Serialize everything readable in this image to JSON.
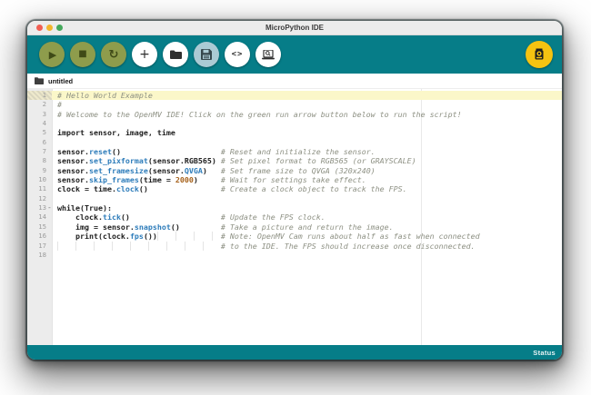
{
  "window": {
    "title": "MicroPython IDE"
  },
  "icons": {
    "play": "▶",
    "stop": "■",
    "reload": "↻",
    "new_file": "+",
    "code": "<>"
  },
  "toolbar": {
    "buttons": [
      {
        "name": "run-script-button",
        "icon": "play-icon"
      },
      {
        "name": "stop-script-button",
        "icon": "stop-icon"
      },
      {
        "name": "reset-camera-button",
        "icon": "reload-icon"
      },
      {
        "name": "new-file-button",
        "icon": "plus-icon"
      },
      {
        "name": "open-file-button",
        "icon": "folder-icon"
      },
      {
        "name": "save-file-button",
        "icon": "floppy-icon"
      },
      {
        "name": "serial-terminal-button",
        "icon": "code-icon"
      },
      {
        "name": "frame-buffer-button",
        "icon": "laptop-zoom-icon"
      },
      {
        "name": "connect-camera-button",
        "icon": "camera-board-icon"
      }
    ]
  },
  "tabbar": {
    "file_label": "untitled"
  },
  "statusbar": {
    "label": "Status"
  },
  "colors": {
    "teal": "#067d88",
    "olive_button": "#8e9c4c",
    "save_button_blue": "#abcad4",
    "connect_yellow": "#f5c311",
    "current_line": "#fbf7c9",
    "comment_gray": "#8d9083",
    "function_blue": "#2d7cba",
    "number_orange": "#a6611a"
  },
  "editor": {
    "lines": [
      {
        "n": 1,
        "cur": true,
        "seg": [
          [
            "c",
            "# Hello World Example"
          ]
        ]
      },
      {
        "n": 2,
        "seg": [
          [
            "c",
            "#"
          ]
        ]
      },
      {
        "n": 3,
        "seg": [
          [
            "c",
            "# Welcome to the OpenMV IDE! Click on the green run arrow button below to run the script!"
          ]
        ]
      },
      {
        "n": 4,
        "seg": []
      },
      {
        "n": 5,
        "seg": [
          [
            "k",
            "import"
          ],
          [
            "v",
            " sensor, image, time"
          ]
        ]
      },
      {
        "n": 6,
        "seg": []
      },
      {
        "n": 7,
        "seg": [
          [
            "v",
            "sensor."
          ],
          [
            "f",
            "reset"
          ],
          [
            "v",
            "()                      "
          ],
          [
            "c",
            "# Reset and initialize the sensor."
          ]
        ]
      },
      {
        "n": 8,
        "seg": [
          [
            "v",
            "sensor."
          ],
          [
            "f",
            "set_pixformat"
          ],
          [
            "v",
            "(sensor.RGB565) "
          ],
          [
            "c",
            "# Set pixel format to RGB565 (or GRAYSCALE)"
          ]
        ]
      },
      {
        "n": 9,
        "seg": [
          [
            "v",
            "sensor."
          ],
          [
            "f",
            "set_framesize"
          ],
          [
            "v",
            "(sensor."
          ],
          [
            "f",
            "QVGA"
          ],
          [
            "v",
            ")   "
          ],
          [
            "c",
            "# Set frame size to QVGA (320x240)"
          ]
        ]
      },
      {
        "n": 10,
        "seg": [
          [
            "v",
            "sensor."
          ],
          [
            "f",
            "skip_frames"
          ],
          [
            "v",
            "(time = "
          ],
          [
            "n2",
            "2000"
          ],
          [
            "v",
            ")     "
          ],
          [
            "c",
            "# Wait for settings take effect."
          ]
        ]
      },
      {
        "n": 11,
        "seg": [
          [
            "v",
            "clock = time."
          ],
          [
            "f",
            "clock"
          ],
          [
            "v",
            "()                "
          ],
          [
            "c",
            "# Create a clock object to track the FPS."
          ]
        ]
      },
      {
        "n": 12,
        "seg": []
      },
      {
        "n": 13,
        "fold": true,
        "seg": [
          [
            "k",
            "while(True):"
          ]
        ]
      },
      {
        "n": 14,
        "seg": [
          [
            "v",
            "    clock."
          ],
          [
            "f",
            "tick"
          ],
          [
            "v",
            "()                    "
          ],
          [
            "c",
            "# Update the FPS clock."
          ]
        ]
      },
      {
        "n": 15,
        "seg": [
          [
            "v",
            "    img = sensor."
          ],
          [
            "f",
            "snapshot"
          ],
          [
            "v",
            "()         "
          ],
          [
            "c",
            "# Take a picture and return the image."
          ]
        ]
      },
      {
        "n": 16,
        "seg": [
          [
            "v",
            "    print(clock."
          ],
          [
            "f",
            "fps"
          ],
          [
            "v",
            "())"
          ],
          [
            "g",
            "              "
          ],
          [
            "c",
            "# Note: OpenMV Cam runs about half as fast when connected"
          ]
        ]
      },
      {
        "n": 17,
        "seg": [
          [
            "g",
            "                                    "
          ],
          [
            "c",
            "# to the IDE. The FPS should increase once disconnected."
          ]
        ]
      },
      {
        "n": 18,
        "seg": []
      }
    ]
  }
}
